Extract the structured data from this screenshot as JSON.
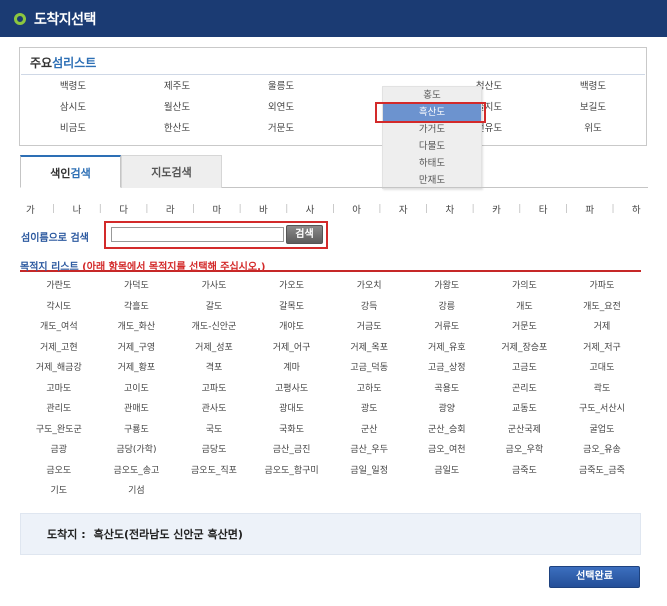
{
  "window": {
    "title": "도착지선택"
  },
  "major_islands": {
    "title_prefix": "주요",
    "title_accent": "섬리스트",
    "items": [
      "백령도",
      "제주도",
      "울릉도",
      "",
      "청산도",
      "백령도",
      "삼시도",
      "월산도",
      "외연도",
      "",
      "울지도",
      "보길도",
      "비금도",
      "한산도",
      "거문도",
      "",
      "선유도",
      "위도"
    ]
  },
  "island_dropdown": {
    "options": [
      "홍도",
      "흑산도",
      "가거도",
      "다물도",
      "하태도",
      "만재도"
    ],
    "selected_index": 1
  },
  "tabs": [
    {
      "label_prefix": "색인",
      "label_accent": "검색",
      "active": true
    },
    {
      "label": "지도검색",
      "active": false
    }
  ],
  "consonant_index": [
    "가",
    "나",
    "다",
    "라",
    "마",
    "바",
    "사",
    "아",
    "자",
    "차",
    "카",
    "타",
    "파",
    "하"
  ],
  "consonant_separator": "|",
  "search": {
    "label": "섬이름으로 검색",
    "value": "",
    "placeholder": "",
    "button_label": "검색"
  },
  "destination_list": {
    "title": "목적지 리스트",
    "note": "(아래 항목에서 목적지를 선택해 주십시오.)",
    "items": [
      "가란도",
      "가덕도",
      "가사도",
      "가오도",
      "가오치",
      "가왕도",
      "가의도",
      "가파도",
      "각시도",
      "각흘도",
      "갈도",
      "갈목도",
      "강득",
      "강릉",
      "개도",
      "개도_요전",
      "개도_여석",
      "개도_화산",
      "개도-신안군",
      "개야도",
      "거금도",
      "거류도",
      "거문도",
      "거제",
      "거제_고현",
      "거제_구영",
      "거제_성포",
      "거제_어구",
      "거제_옥포",
      "거제_유호",
      "거제_장승포",
      "거제_저구",
      "거제_해금강",
      "거제_황포",
      "격포",
      "계마",
      "고금_덕동",
      "고금_상정",
      "고금도",
      "고대도",
      "고마도",
      "고이도",
      "고파도",
      "고평사도",
      "고하도",
      "곡용도",
      "곤리도",
      "곽도",
      "관리도",
      "관매도",
      "관사도",
      "광대도",
      "광도",
      "광양",
      "교동도",
      "구도_서산시",
      "구도_완도군",
      "구룡도",
      "국도",
      "국화도",
      "군산",
      "군산_승회",
      "군산국제",
      "굴업도",
      "금광",
      "금당(가학)",
      "금당도",
      "금산_금진",
      "금산_우두",
      "금오_여천",
      "금오_우학",
      "금오_유송",
      "금오도",
      "금오도_송고",
      "금오도_직포",
      "금오도_함구미",
      "금일_일정",
      "금일도",
      "금죽도",
      "금죽도_금죽",
      "기도",
      "기섬"
    ]
  },
  "destination_summary": {
    "label": "도착지 :",
    "value": "흑산도(전라남도 신안군 흑산면)"
  },
  "confirm_button": {
    "label": "선택완료"
  },
  "colors": {
    "titlebar": "#1b3b73",
    "accent_blue": "#2d6fb5",
    "highlight_red": "#d32a2a",
    "dropdown_selected": "#6c93cf",
    "confirm_button": "#2c5aa8"
  }
}
